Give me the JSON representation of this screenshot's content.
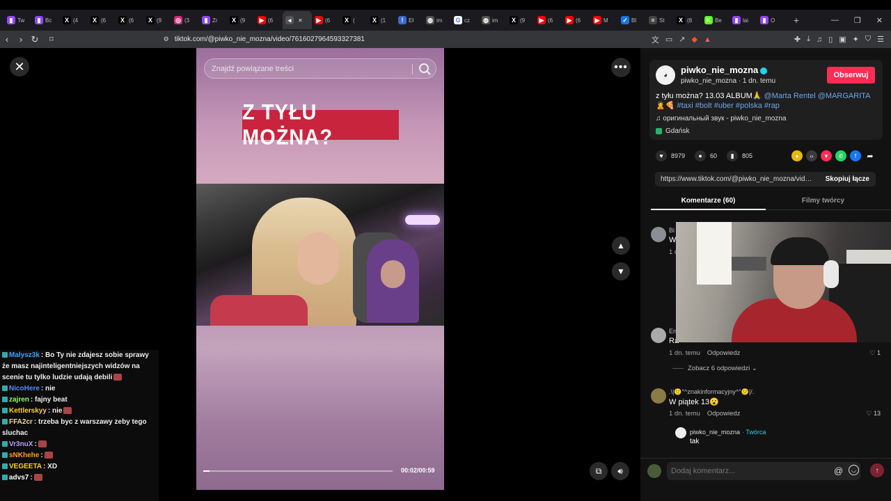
{
  "browser": {
    "tabs": [
      {
        "icon": "twitch-icon",
        "label": "Tw",
        "color": "#9146ff"
      },
      {
        "icon": "twitch-icon",
        "label": "Bc",
        "color": "#9146ff"
      },
      {
        "icon": "x-icon",
        "label": "(4",
        "color": "#000000"
      },
      {
        "icon": "x-icon",
        "label": "(6",
        "color": "#000000"
      },
      {
        "icon": "x-icon",
        "label": "(6",
        "color": "#000000"
      },
      {
        "icon": "x-icon",
        "label": "(9",
        "color": "#000000"
      },
      {
        "icon": "instagram-icon",
        "label": "(3",
        "color": "#d62976"
      },
      {
        "icon": "twitch-icon",
        "label": "Zr",
        "color": "#9146ff"
      },
      {
        "icon": "x-icon",
        "label": "(9",
        "color": "#000000"
      },
      {
        "icon": "youtube-icon",
        "label": "(6",
        "color": "#ff0000"
      },
      {
        "icon": "speaker-icon",
        "label": "",
        "color": "#555555",
        "active": true
      },
      {
        "icon": "youtube-icon",
        "label": "(6",
        "color": "#ff0000"
      },
      {
        "icon": "x-icon",
        "label": "(",
        "color": "#000000"
      },
      {
        "icon": "x-icon",
        "label": "(1",
        "color": "#000000"
      },
      {
        "icon": "bookmark-icon",
        "label": "Eł",
        "color": "#3a6ad6"
      },
      {
        "icon": "globe-icon",
        "label": "im",
        "color": "#555555"
      },
      {
        "icon": "google-icon",
        "label": "cz",
        "color": "#ffffff"
      },
      {
        "icon": "globe-icon",
        "label": "im",
        "color": "#555555"
      },
      {
        "icon": "x-icon",
        "label": "(9",
        "color": "#000000"
      },
      {
        "icon": "youtube-icon",
        "label": "(6",
        "color": "#ff0000"
      },
      {
        "icon": "youtube-icon",
        "label": "(6",
        "color": "#ff0000"
      },
      {
        "icon": "youtube-icon",
        "label": "M",
        "color": "#ff0000"
      },
      {
        "icon": "check-icon",
        "label": "Bl",
        "color": "#1a73e8"
      },
      {
        "icon": "stack-icon",
        "label": "St",
        "color": "#444444"
      },
      {
        "icon": "x-icon",
        "label": "(8",
        "color": "#000000"
      },
      {
        "icon": "kick-icon",
        "label": "Be",
        "color": "#53fc18"
      },
      {
        "icon": "twitch-icon",
        "label": "lai",
        "color": "#9146ff"
      },
      {
        "icon": "twitch-icon",
        "label": "O",
        "color": "#9146ff"
      }
    ],
    "url": "tiktok.com/@piwko_nie_mozna/video/7616027964593327381"
  },
  "video": {
    "search_placeholder": "Znajdź powiązane treści",
    "title_card": "Z TYŁU MOŻNA?",
    "time": "00:02/00:59",
    "progress": 0.034
  },
  "chat": [
    {
      "user": "Malysz3k",
      "user_color": "#36a3ff",
      "text": ": Bo Ty nie zdajesz sobie sprawy że masz najinteligentniejszych widzów na scenie tu tylko ludzie udają debili",
      "emote": true
    },
    {
      "user": "NicoHere",
      "user_color": "#4d8cff",
      "text": ": nie",
      "emote": false
    },
    {
      "user": "zajren",
      "user_color": "#8cff5a",
      "text": ": fajny beat",
      "emote": false
    },
    {
      "user": "Kettlerskyy",
      "user_color": "#ffd21f",
      "text": ": nie",
      "emote": true
    },
    {
      "user": "FFA2cr",
      "user_color": "#f0d6a0",
      "text": ": trzeba byc z warszawy zeby tego sluchac",
      "emote": false
    },
    {
      "user": "Vr3nuX",
      "user_color": "#b99ef7",
      "text": ":",
      "emote": true
    },
    {
      "user": "sNKhehe",
      "user_color": "#ff9f1a",
      "text": ":",
      "emote": true
    },
    {
      "user": "VEGEETA",
      "user_color": "#ffd21f",
      "text": ": XD",
      "emote": false
    },
    {
      "user": "advs7",
      "user_color": "#ffffff",
      "text": ":",
      "emote": true
    }
  ],
  "post": {
    "username": "piwko_nie_mozna",
    "subline": "piwko_nie_mozna · 1 dn. temu",
    "follow_label": "Obserwuj",
    "desc_text": "z tyłu można? 13.03 ALBUM🙏",
    "desc_links": [
      "@Marta Rentel",
      "@MARGARITA🙎🍕",
      "#taxi",
      "#bolt",
      "#uber",
      "#polska",
      "#rap"
    ],
    "sound": "оригинальный звук - piwko_nie_mozna",
    "location": "Gdańsk",
    "likes": "8979",
    "comments": "60",
    "saves": "805",
    "share_url": "https://www.tiktok.com/@piwko_nie_mozna/video/...",
    "copy_label": "Skopiuj łącze",
    "tab_comments": "Komentarze (60)",
    "tab_creator": "Filmy twórcy"
  },
  "comments": [
    {
      "name": "Bi",
      "text": "W",
      "time": "1 d",
      "reply": "",
      "likes": ""
    },
    {
      "name": "En",
      "text": "Ra",
      "time": "1 dn. temu",
      "reply": "Odpowiedz",
      "likes": "1"
    },
    {
      "name": ".\\|🙂°^znakinformacyjny^°🙂|/.",
      "text": "W piątek 13😮",
      "time": "1 dn. temu",
      "reply": "Odpowiedz",
      "likes": "13"
    }
  ],
  "see_replies": "Zobacz 6 odpowiedzi",
  "creator_reply": {
    "name": "piwko_nie_mozna",
    "role": "· Twórca",
    "text": "tak"
  },
  "comment_box": {
    "placeholder": "Dodaj komentarz..."
  }
}
